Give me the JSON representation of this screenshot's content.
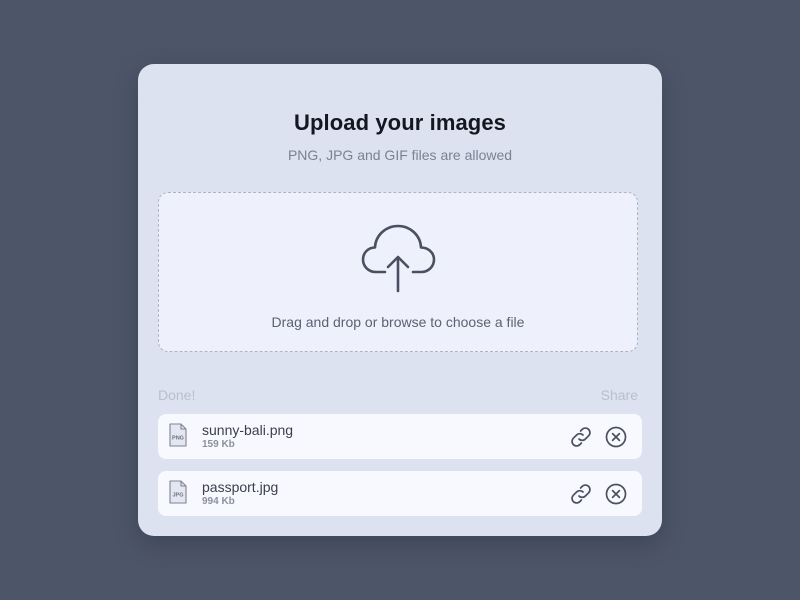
{
  "card": {
    "title": "Upload your images",
    "subtitle": "PNG, JPG and GIF files are allowed"
  },
  "dropzone": {
    "icon": "cloud-upload-icon",
    "text": "Drag and drop or browse to choose a file"
  },
  "list": {
    "status_label": "Done!",
    "share_label": "Share"
  },
  "files": [
    {
      "name": "sunny-bali.png",
      "size": "159 Kb",
      "type_badge": "PNG"
    },
    {
      "name": "passport.jpg",
      "size": "994 Kb",
      "type_badge": "JPG"
    }
  ],
  "icons": {
    "file": "file-icon",
    "link": "link-icon",
    "remove": "close-circle-icon"
  },
  "colors": {
    "background": "#4d5568",
    "card": "#dde2f0",
    "dropzone": "#eef0fc",
    "row": "#f8f9fe",
    "icon": "#4a5060"
  }
}
